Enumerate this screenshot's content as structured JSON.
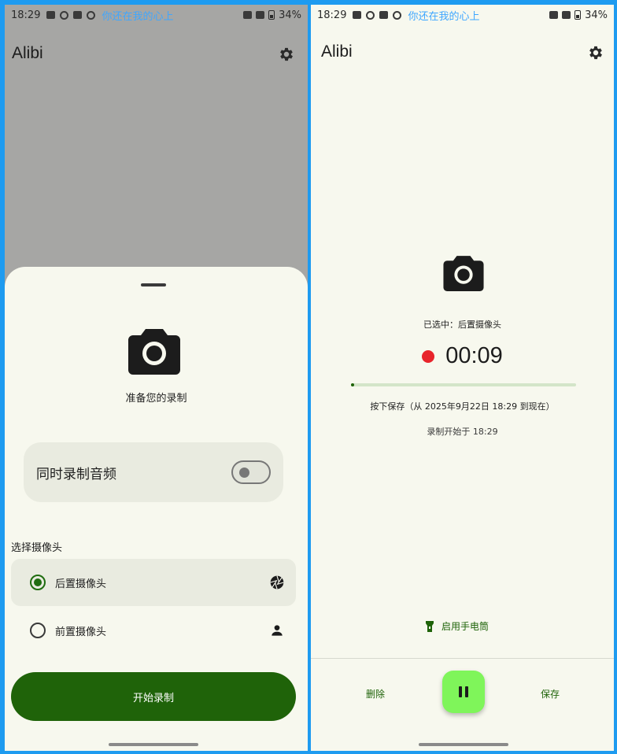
{
  "status_bar": {
    "time": "18:29",
    "marquee": "你还在我的心上",
    "battery": "34%"
  },
  "app": {
    "title": "Alibi"
  },
  "left": {
    "ready_text": "准备您的录制",
    "audio_toggle": {
      "label": "同时录制音频",
      "enabled": false
    },
    "camera_section_title": "选择摄像头",
    "cameras": [
      {
        "label": "后置摄像头",
        "selected": true,
        "icon": "aperture-icon"
      },
      {
        "label": "前置摄像头",
        "selected": false,
        "icon": "person-icon"
      }
    ],
    "start_button": "开始录制"
  },
  "right": {
    "selected_camera_text": "已选中：后置摄像头",
    "timer": "00:09",
    "progress_fraction": 0.01,
    "save_hint": "按下保存（从 2025年9月22日 18:29 到现在）",
    "recording_start": "录制开始于 18:29",
    "flashlight_button": "启用手电筒",
    "delete_button": "删除",
    "save_button": "保存"
  },
  "colors": {
    "accent_green": "#1f6309",
    "pause_button": "#7ff55a",
    "record_dot": "#e8242b",
    "frame_blue": "#1e9bf0"
  }
}
